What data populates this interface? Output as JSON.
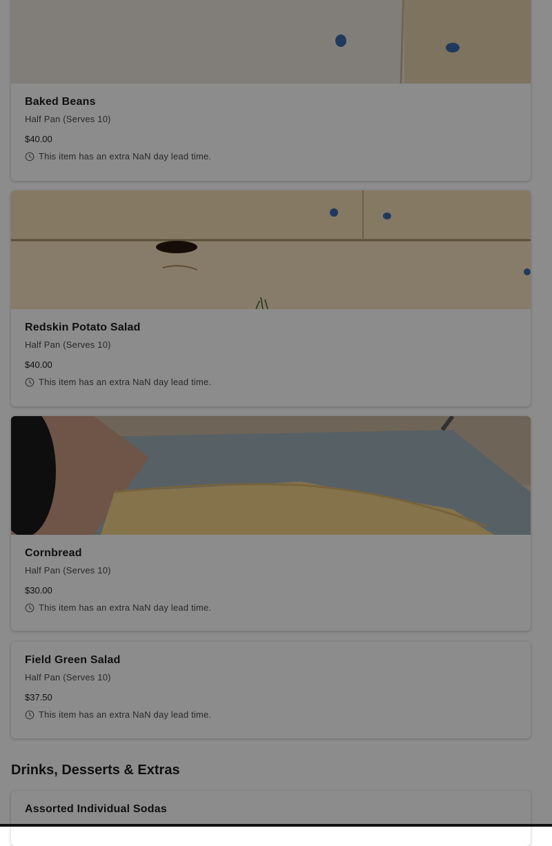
{
  "items": [
    {
      "name": "Baked Beans",
      "portion": "Half Pan (Serves 10)",
      "price": "$40.00",
      "lead_time": "This item has an extra NaN day lead time.",
      "image_icon": "photo-wood-planks"
    },
    {
      "name": "Redskin Potato Salad",
      "portion": "Half Pan (Serves 10)",
      "price": "$40.00",
      "lead_time": "This item has an extra NaN day lead time.",
      "image_icon": "photo-wood-planks"
    },
    {
      "name": "Cornbread",
      "portion": "Half Pan (Serves 10)",
      "price": "$30.00",
      "lead_time": "This item has an extra NaN day lead time.",
      "image_icon": "photo-cornbread"
    },
    {
      "name": "Field Green Salad",
      "portion": "Half Pan (Serves 10)",
      "price": "$37.50",
      "lead_time": "This item has an extra NaN day lead time."
    }
  ],
  "section": {
    "title": "Drinks, Desserts & Extras"
  },
  "next_items": [
    {
      "name": "Assorted Individual Sodas"
    }
  ],
  "icons": {
    "lead_time_icon": "clock-icon"
  },
  "colors": {
    "overlay": "#000000",
    "text": "#1c1c1c",
    "muted": "#4a4a4a"
  }
}
